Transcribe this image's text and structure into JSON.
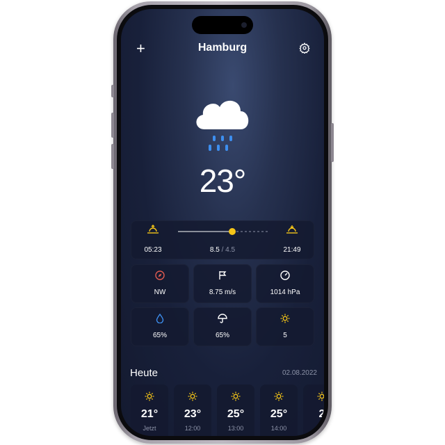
{
  "header": {
    "city": "Hamburg"
  },
  "current": {
    "temperature": "23°",
    "condition_icon": "cloud-rain-icon"
  },
  "sun": {
    "sunrise": "05:23",
    "sunset": "21:49",
    "uv_current": "8.5",
    "uv_separator": " / ",
    "uv_max": "4.5",
    "progress": 0.6
  },
  "tiles": [
    {
      "icon": "compass-icon",
      "value": "NW"
    },
    {
      "icon": "flag-icon",
      "value": "8.75 m/s"
    },
    {
      "icon": "gauge-icon",
      "value": "1014 hPa"
    },
    {
      "icon": "droplet-icon",
      "value": "65%"
    },
    {
      "icon": "umbrella-icon",
      "value": "65%"
    },
    {
      "icon": "sun-icon",
      "value": "5"
    }
  ],
  "today": {
    "label": "Heute",
    "date": "02.08.2022"
  },
  "hourly": [
    {
      "temp": "21°",
      "time": "Jetzt"
    },
    {
      "temp": "23°",
      "time": "12:00"
    },
    {
      "temp": "25°",
      "time": "13:00"
    },
    {
      "temp": "25°",
      "time": "14:00"
    },
    {
      "temp": "2",
      "time": ""
    }
  ],
  "colors": {
    "accent": "#f5c518",
    "rain": "#3d8ff0",
    "background": "#18203a",
    "card": "#141a30"
  }
}
